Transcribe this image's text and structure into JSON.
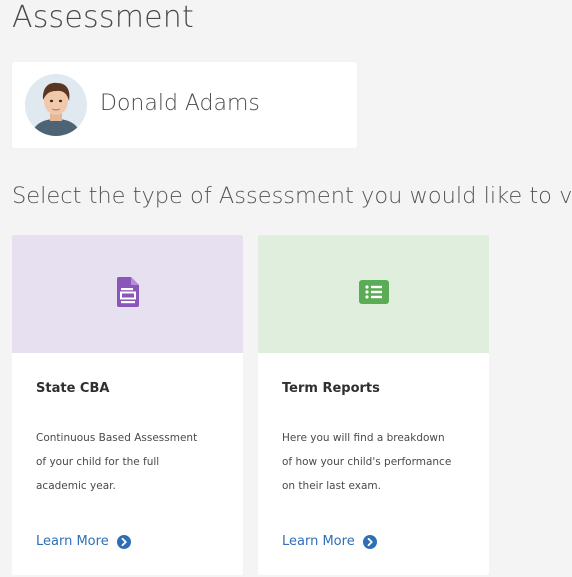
{
  "page": {
    "title": "Assessment",
    "prompt": "Select the type of Assessment you would like to view"
  },
  "user": {
    "name": "Donald Adams",
    "avatar_icon": "student-portrait"
  },
  "cards": [
    {
      "title": "State CBA",
      "description_lines": [
        "Continuous Based Assessment",
        "of your child for the full",
        "academic year."
      ],
      "link_label": "Learn More",
      "banner_color": "#e6e0f0",
      "icon": "document-icon",
      "icon_color": "#8a57b8"
    },
    {
      "title": "Term Reports",
      "description_lines": [
        "Here you will find a breakdown",
        "of how your child's performance",
        "on their last exam."
      ],
      "link_label": "Learn More",
      "banner_color": "#dfeedd",
      "icon": "list-icon",
      "icon_color": "#5aac55"
    }
  ],
  "colors": {
    "link": "#2f6fb5",
    "background": "#f4f4f5"
  }
}
